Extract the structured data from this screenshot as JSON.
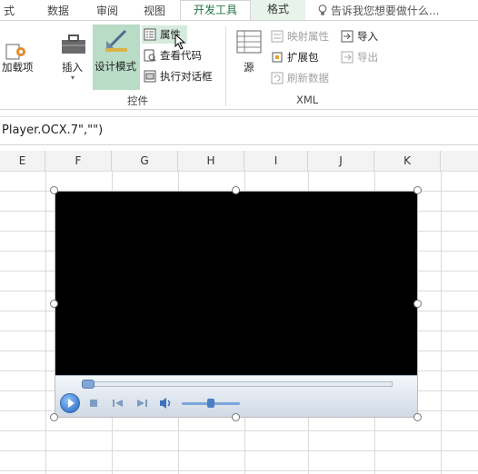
{
  "tabs": {
    "formulas_partial": "式",
    "data": "数据",
    "review": "审阅",
    "view": "视图",
    "developer": "开发工具",
    "format": "格式",
    "tell_me": "告诉我您想要做什么..."
  },
  "ribbon": {
    "addins_partial": "加载项",
    "insert": "插入",
    "design_mode": "设计模式",
    "properties": "属性",
    "view_code": "查看代码",
    "run_dialog": "执行对话框",
    "controls_group": "控件",
    "source": "源",
    "map_properties": "映射属性",
    "expansion_packs": "扩展包",
    "refresh_data": "刷新数据",
    "import": "导入",
    "export": "导出",
    "xml_group": "XML"
  },
  "formula_bar": {
    "text": "Player.OCX.7\",\"\")"
  },
  "columns": [
    "E",
    "F",
    "G",
    "H",
    "I",
    "J",
    "K"
  ],
  "colors": {
    "accent": "#217346",
    "design_mode_active": "#b9dcc7",
    "video_bg": "#000000"
  }
}
